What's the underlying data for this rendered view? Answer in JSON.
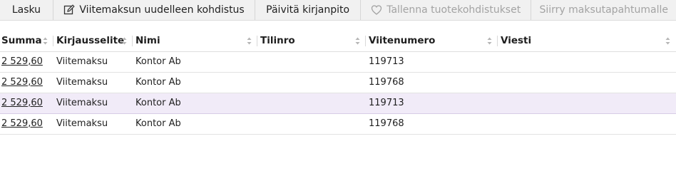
{
  "toolbar": {
    "lasku": "Lasku",
    "viitemaksun_kohdistus": "Viitemaksun uudelleen kohdistus",
    "paivita_kirjanpito": "Päivitä kirjanpito",
    "tallenna_tuotekohdistukset": "Tallenna tuotekohdistukset",
    "siirry_maksutapahtumalle": "Siirry maksutapahtumalle"
  },
  "table": {
    "columns": [
      "Summa",
      "Kirjausselite",
      "Nimi",
      "Tilinro",
      "Viitenumero",
      "Viesti"
    ],
    "rows": [
      {
        "summa": "2 529,60",
        "kirjausselite": "Viitemaksu",
        "nimi": "Kontor Ab",
        "tilinro": "",
        "viitenumero": "119713",
        "viesti": ""
      },
      {
        "summa": "2 529,60",
        "kirjausselite": "Viitemaksu",
        "nimi": "Kontor Ab",
        "tilinro": "",
        "viitenumero": "119768",
        "viesti": ""
      },
      {
        "summa": "2 529,60",
        "kirjausselite": "Viitemaksu",
        "nimi": "Kontor Ab",
        "tilinro": "",
        "viitenumero": "119713",
        "viesti": ""
      },
      {
        "summa": "2 529,60",
        "kirjausselite": "Viitemaksu",
        "nimi": "Kontor Ab",
        "tilinro": "",
        "viitenumero": "119768",
        "viesti": ""
      }
    ]
  },
  "colors": {
    "selected_row": "#f1ebf8",
    "disabled_text": "#a3a3a3"
  }
}
